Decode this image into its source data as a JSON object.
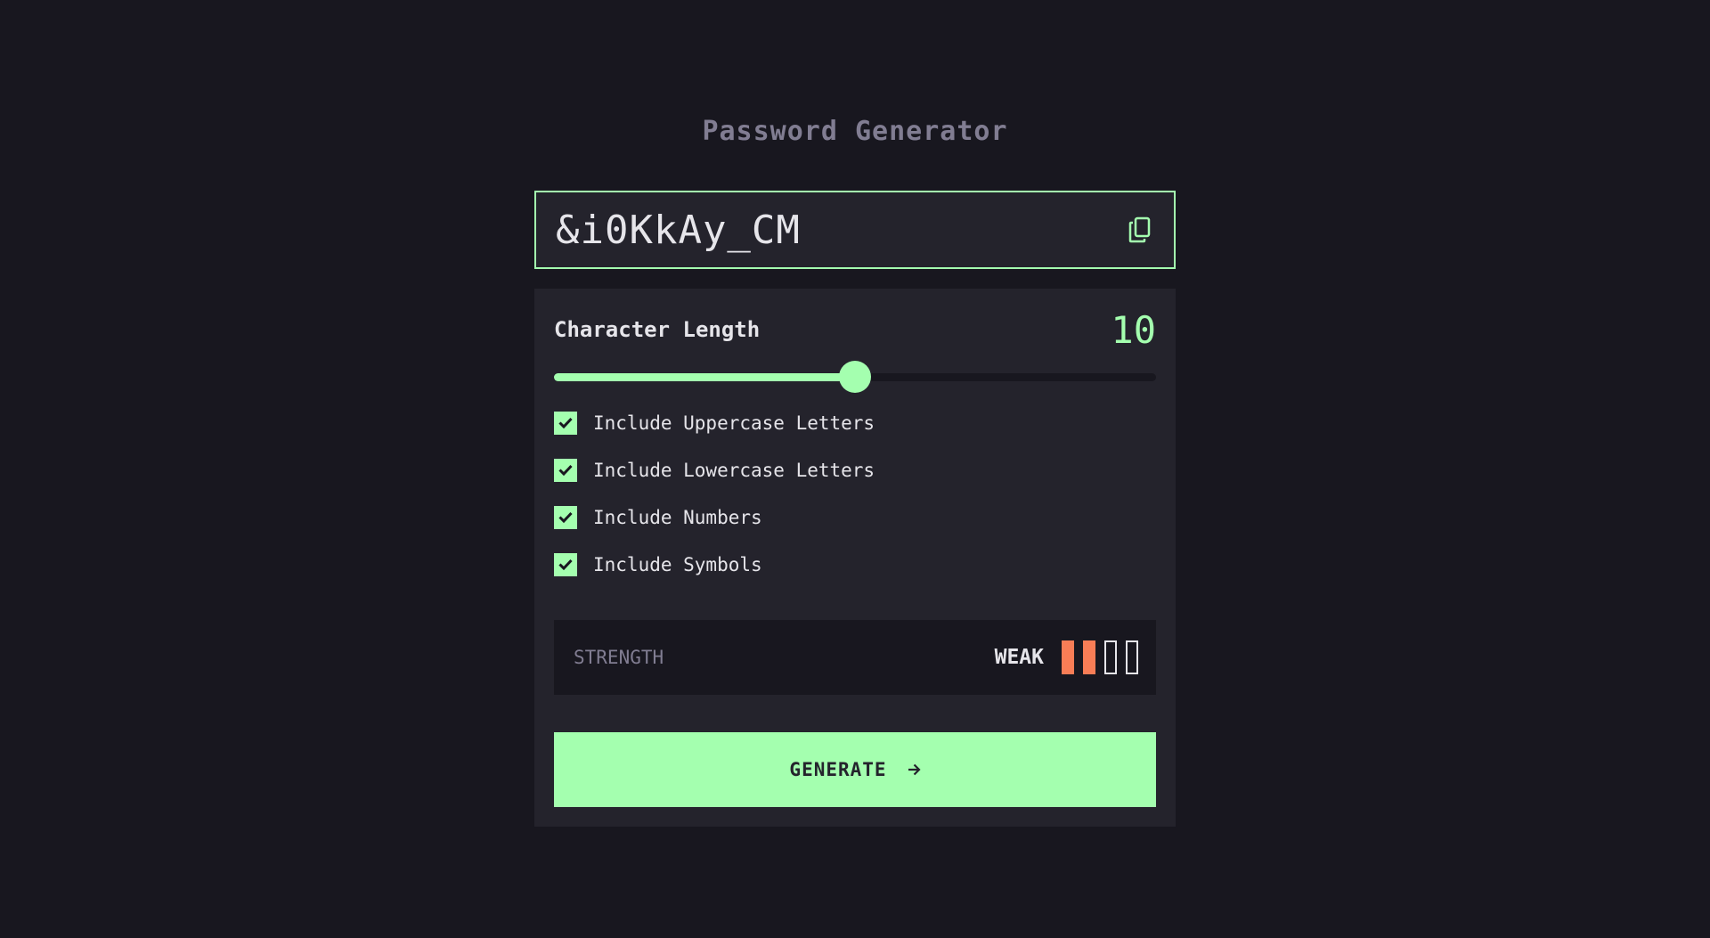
{
  "header": {
    "title": "Password Generator"
  },
  "output": {
    "password": "&i0KkAy_CM",
    "copy_icon": "copy-icon"
  },
  "length": {
    "label": "Character Length",
    "value": "10",
    "slider_fraction": 0.5
  },
  "options": [
    {
      "label": "Include Uppercase Letters",
      "checked": true
    },
    {
      "label": "Include Lowercase Letters",
      "checked": true
    },
    {
      "label": "Include Numbers",
      "checked": true
    },
    {
      "label": "Include Symbols",
      "checked": true
    }
  ],
  "strength": {
    "label": "STRENGTH",
    "level": "WEAK",
    "filled_bars": 2,
    "total_bars": 4,
    "bar_color": "#f87d56"
  },
  "generate": {
    "label": "GENERATE",
    "icon": "arrow-right-icon"
  },
  "colors": {
    "background": "#18171f",
    "panel": "#24232c",
    "accent": "#a4ffaf",
    "muted_text": "#817d92",
    "text": "#e6e5ea"
  }
}
